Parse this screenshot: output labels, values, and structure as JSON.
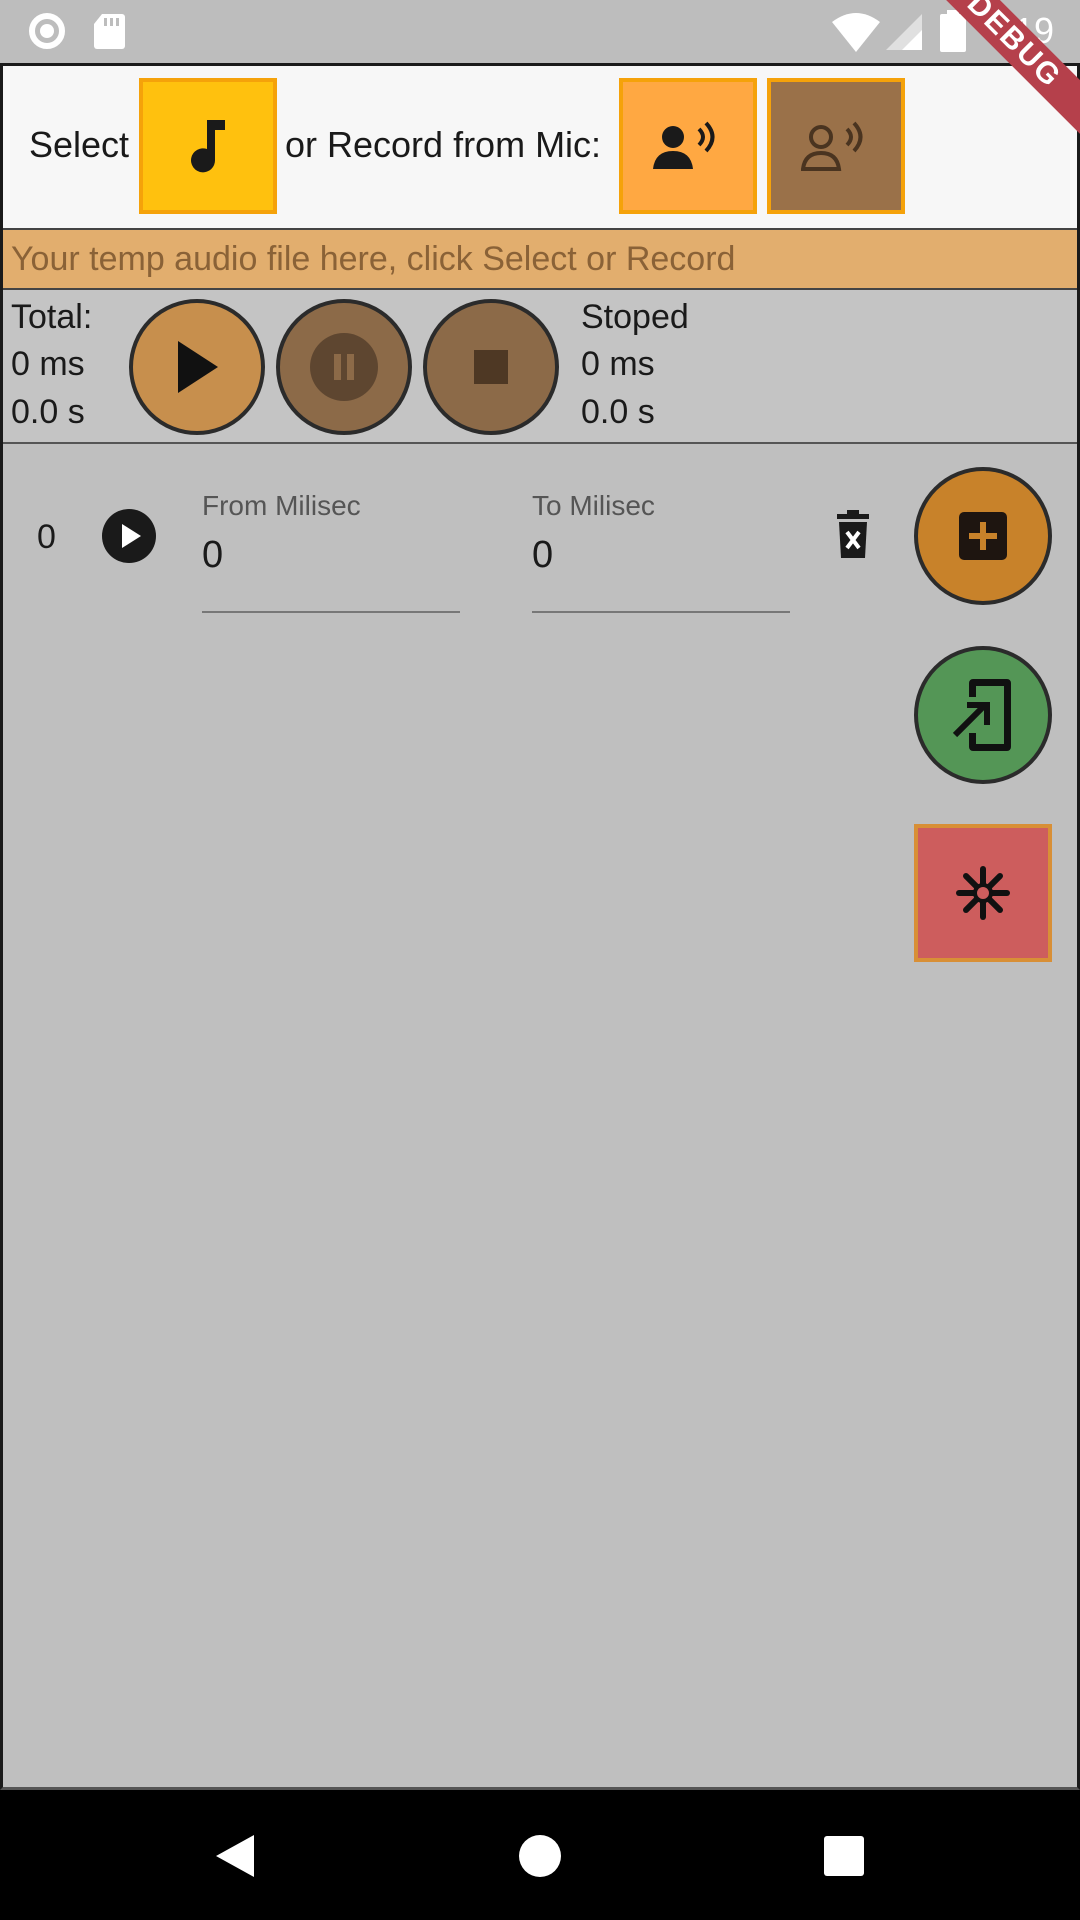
{
  "status_bar": {
    "time": "8:19",
    "icons": [
      "circle-notification-icon",
      "sd-card-icon",
      "wifi-icon",
      "signal-icon",
      "battery-icon"
    ]
  },
  "debug_banner": "DEBUG",
  "header": {
    "select_label": "Select",
    "record_label": "or Record from Mic:",
    "colors": {
      "select_button": "#ffc10e",
      "record_button": "#ffa842",
      "record_stop_button": "#9a7149",
      "border": "#f5a20a"
    }
  },
  "temp_file": {
    "text": "Your temp audio file here, click Select or Record",
    "color": "#e2ae6e"
  },
  "player": {
    "total_label": "Total:",
    "total_ms": "0 ms",
    "total_s": "0.0 s",
    "status": "Stoped",
    "position_ms": "0 ms",
    "position_s": "0.0 s",
    "buttons": [
      "play-icon",
      "pause-icon",
      "stop-icon"
    ]
  },
  "segments": [
    {
      "index": "0",
      "from_label": "From Milisec",
      "from_value": "0",
      "to_label": "To Milisec",
      "to_value": "0"
    }
  ],
  "fabs": {
    "add_color": "#c8822a",
    "export_color": "#549656",
    "clear_color": "#cd5d5d"
  }
}
